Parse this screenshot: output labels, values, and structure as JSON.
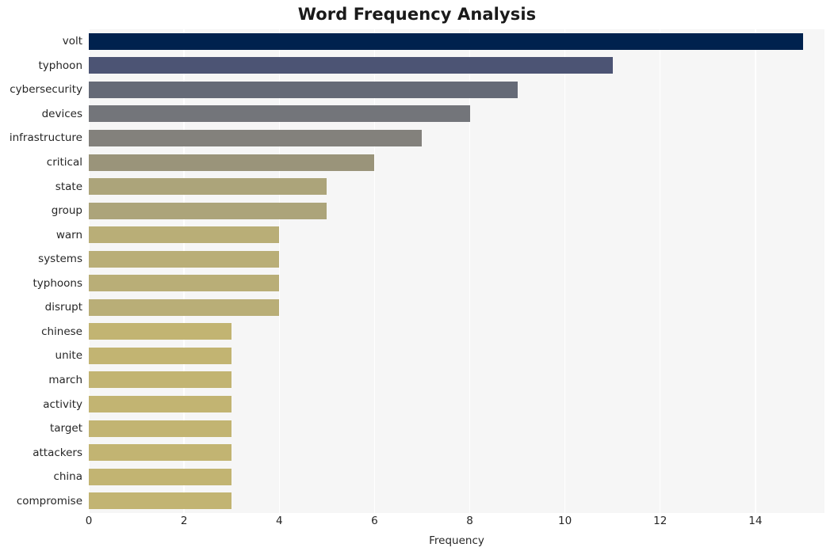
{
  "chart_data": {
    "type": "bar",
    "orientation": "horizontal",
    "title": "Word Frequency Analysis",
    "xlabel": "Frequency",
    "ylabel": "",
    "categories": [
      "volt",
      "typhoon",
      "cybersecurity",
      "devices",
      "infrastructure",
      "critical",
      "state",
      "group",
      "warn",
      "systems",
      "typhoons",
      "disrupt",
      "chinese",
      "unite",
      "march",
      "activity",
      "target",
      "attackers",
      "china",
      "compromise"
    ],
    "values": [
      15,
      11,
      9,
      8,
      7,
      6,
      5,
      5,
      4,
      4,
      4,
      4,
      3,
      3,
      3,
      3,
      3,
      3,
      3,
      3
    ],
    "bar_colors": [
      "#00224e",
      "#4c5474",
      "#656a77",
      "#73757a",
      "#83817c",
      "#9a947a",
      "#aca47a",
      "#aca47a",
      "#b9ae77",
      "#b9ae77",
      "#b9ae77",
      "#b9ae77",
      "#c2b472",
      "#c2b472",
      "#c2b472",
      "#c2b472",
      "#c2b472",
      "#c2b472",
      "#c2b472",
      "#c2b472"
    ],
    "xticks": [
      0,
      2,
      4,
      6,
      8,
      10,
      12,
      14
    ],
    "xticklabels": [
      "0",
      "2",
      "4",
      "6",
      "8",
      "10",
      "12",
      "14"
    ],
    "xlim": [
      0,
      15.45
    ],
    "grid": true,
    "grid_axis": "x",
    "legend": null,
    "colormap": "cividis",
    "plot_background": "#f6f6f6",
    "gridline_color": "#ffffff",
    "figure_background": "#ffffff"
  }
}
